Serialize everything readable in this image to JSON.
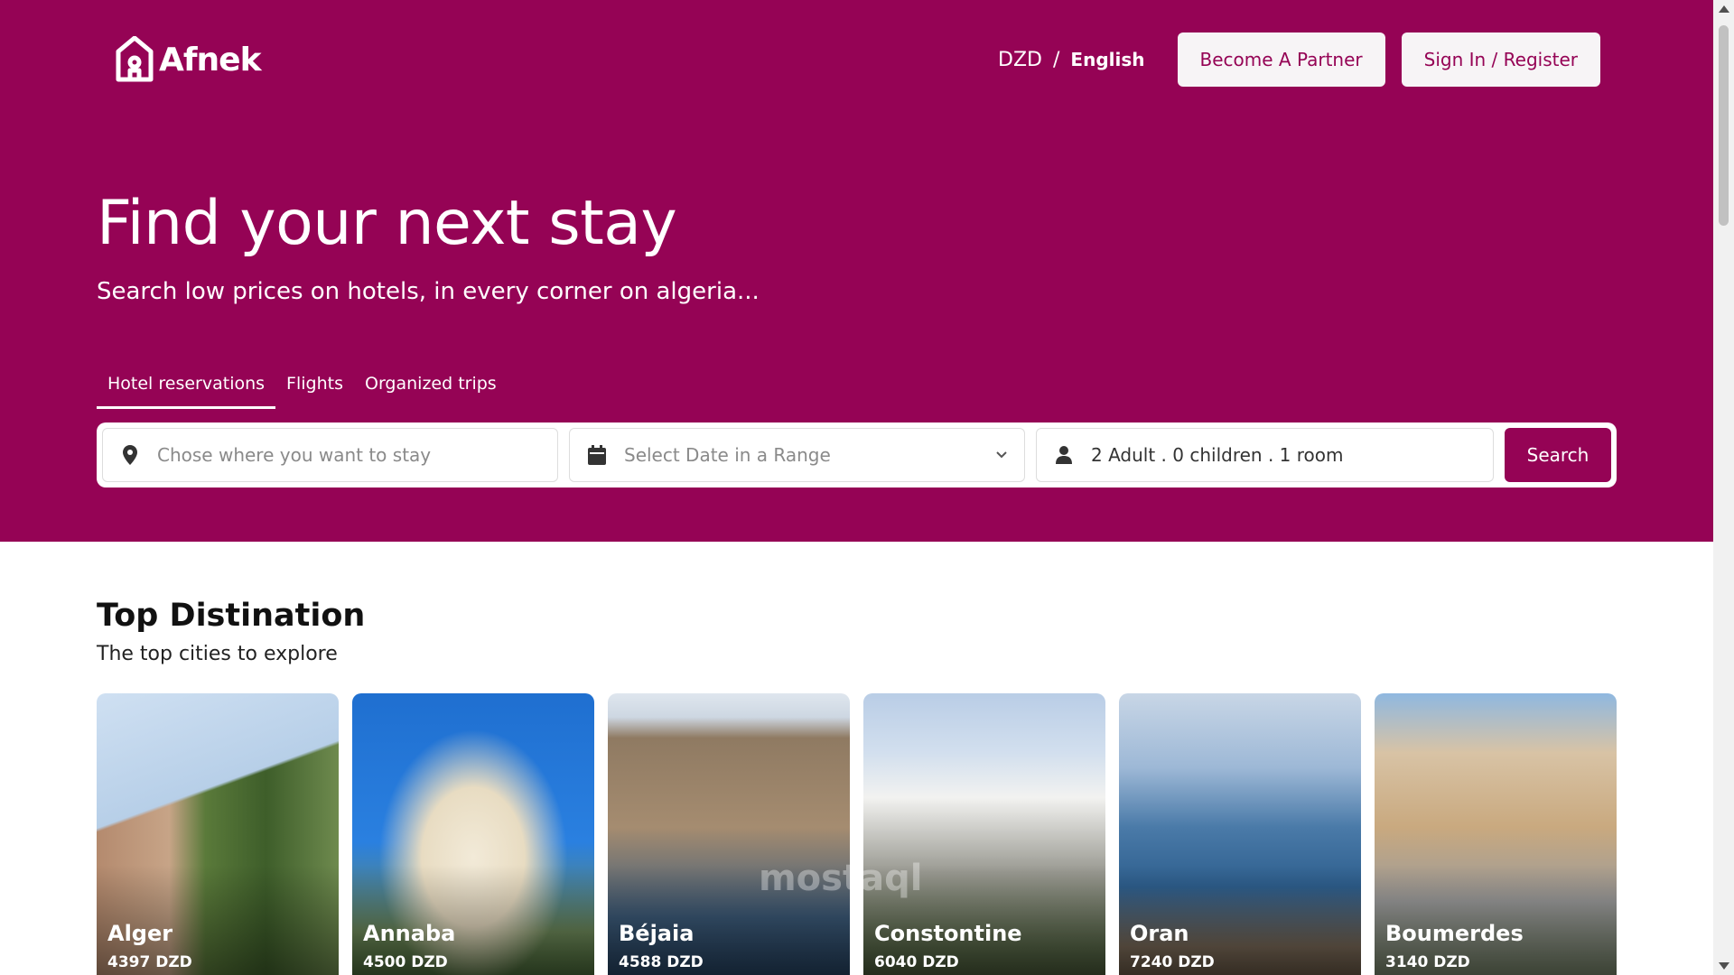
{
  "app": {
    "logo_text": "Afnek",
    "brand_color": "#950355"
  },
  "header": {
    "currency": "DZD",
    "separator": "/",
    "language": "English",
    "partner_button": "Become A Partner",
    "signin_button": "Sign In / Register"
  },
  "hero": {
    "title": "Find your next stay",
    "subtitle": "Search low prices on hotels, in every corner on algeria..."
  },
  "tabs": [
    {
      "label": "Hotel reservations",
      "active": true
    },
    {
      "label": "Flights",
      "active": false
    },
    {
      "label": "Organized trips",
      "active": false
    }
  ],
  "search": {
    "location_placeholder": "Chose where you want to stay",
    "date_placeholder": "Select Date in a Range",
    "guests_value": "2 Adult . 0 children . 1 room",
    "button": "Search",
    "icons": {
      "location": "map-pin-icon",
      "date": "calendar-icon",
      "guests": "person-icon",
      "dropdown": "chevron-down-icon"
    }
  },
  "destinations": {
    "title": "Top Distination",
    "subtitle": "The top cities to explore",
    "items": [
      {
        "name": "Alger",
        "price": "4397 DZD"
      },
      {
        "name": "Annaba",
        "price": "4500 DZD"
      },
      {
        "name": "Béjaia",
        "price": "4588 DZD"
      },
      {
        "name": "Constontine",
        "price": "6040 DZD"
      },
      {
        "name": "Oran",
        "price": "7240 DZD"
      },
      {
        "name": "Boumerdes",
        "price": "3140 DZD"
      }
    ]
  },
  "watermark": "mostaql"
}
